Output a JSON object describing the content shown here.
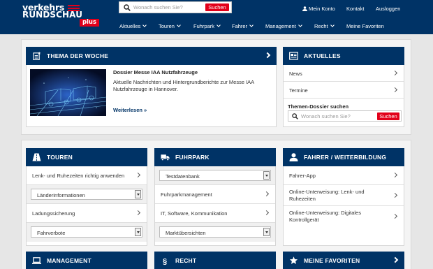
{
  "logo": {
    "line1": "verkehrs",
    "line2": "RUNDSCHAU",
    "plus": "plus"
  },
  "search": {
    "placeholder": "Wonach suchen Sie?",
    "button": "Suchen"
  },
  "toplinks": {
    "account": "Mein Konto",
    "contact": "Kontakt",
    "logout": "Ausloggen"
  },
  "nav": [
    "Aktuelles",
    "Touren",
    "Fuhrpark",
    "Fahrer",
    "Management",
    "Recht",
    "Meine Favoriten"
  ],
  "thema": {
    "title": "THEMA DER WOCHE",
    "headline": "Dossier Messe IAA Nutzfahrzeuge",
    "text": "Aktuelle Nachrichten und Hintergrundberichte zur Messe IAA Nutzfahrzeuge in Hannover.",
    "more": "Weiterlesen »"
  },
  "aktuelles": {
    "title": "AKTUELLES",
    "items": [
      "News",
      "Termine"
    ],
    "themen_label": "Themen-Dossier suchen",
    "search_placeholder": "Wonach suchen Sie?",
    "search_button": "Suchen"
  },
  "touren": {
    "title": "TOUREN",
    "row1": "Lenk- und Ruhezeiten richtig anwenden",
    "select1": "Länderinformationen",
    "row3": "Ladungssicherung",
    "select2": "Fahrverbote"
  },
  "fuhrpark": {
    "title": "FUHRPARK",
    "select1": "Testdatenbank",
    "row2": "Fuhrparkmanagement",
    "row3": "IT, Software, Kommunikation",
    "select2": "Marktübersichten"
  },
  "fahrer": {
    "title": "FAHRER / WEITERBILDUNG",
    "row1": "Fahrer-App",
    "row2": "Online-Unterweisung: Lenk- und Ruhezeiten",
    "row3": "Online-Unterweisung: Digitales Kontrollgerät"
  },
  "bottom": {
    "management": "MANAGEMENT",
    "recht": "RECHT",
    "favoriten": "MEINE FAVORITEN"
  },
  "colors": {
    "navy": "#003366",
    "red": "#e2001a",
    "background": "#e6e6e6"
  }
}
